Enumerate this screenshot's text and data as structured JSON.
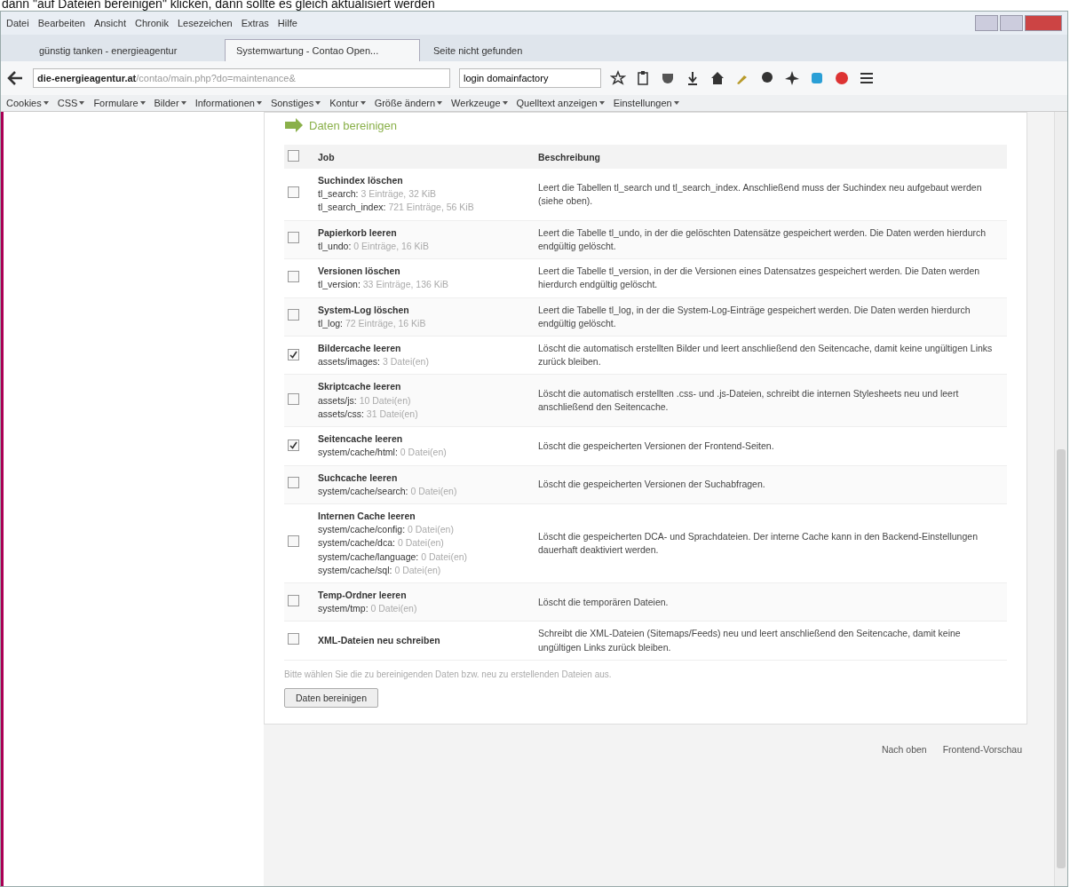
{
  "caption": "dann \"auf Dateien bereinigen\" klicken, dann sollte es gleich aktualisiert werden",
  "menu": [
    "Datei",
    "Bearbeiten",
    "Ansicht",
    "Chronik",
    "Lesezeichen",
    "Extras",
    "Hilfe"
  ],
  "tabs": [
    {
      "label": "günstig tanken - energieagentur",
      "selected": false
    },
    {
      "label": "Systemwartung - Contao Open...",
      "selected": true
    },
    {
      "label": "Seite nicht gefunden",
      "selected": false
    }
  ],
  "address": {
    "host": "die-energieagentur.at",
    "path": "/contao/main.php?do=maintenance&"
  },
  "search": {
    "value": "login domainfactory"
  },
  "dev_toolbar": [
    "Cookies",
    "CSS",
    "Formulare",
    "Bilder",
    "Informationen",
    "Sonstiges",
    "Kontur",
    "Größe ändern",
    "Werkzeuge",
    "Quelltext anzeigen",
    "Einstellungen"
  ],
  "section": {
    "title": "Daten bereinigen",
    "columns": [
      "Job",
      "Beschreibung"
    ],
    "select_all": {
      "checked": false
    },
    "jobs": [
      {
        "name": "Suchindex löschen",
        "checked": false,
        "details": [
          {
            "path": "tl_search:",
            "info": "3 Einträge, 32 KiB"
          },
          {
            "path": "tl_search_index:",
            "info": "721 Einträge, 56 KiB"
          }
        ],
        "description": "Leert die Tabellen tl_search und tl_search_index. Anschließend muss der Suchindex neu aufgebaut werden (siehe oben)."
      },
      {
        "name": "Papierkorb leeren",
        "checked": false,
        "details": [
          {
            "path": "tl_undo:",
            "info": "0 Einträge, 16 KiB"
          }
        ],
        "description": "Leert die Tabelle tl_undo, in der die gelöschten Datensätze gespeichert werden. Die Daten werden hierdurch endgültig gelöscht."
      },
      {
        "name": "Versionen löschen",
        "checked": false,
        "details": [
          {
            "path": "tl_version:",
            "info": "33 Einträge, 136 KiB"
          }
        ],
        "description": "Leert die Tabelle tl_version, in der die Versionen eines Datensatzes gespeichert werden. Die Daten werden hierdurch endgültig gelöscht."
      },
      {
        "name": "System-Log löschen",
        "checked": false,
        "details": [
          {
            "path": "tl_log:",
            "info": "72 Einträge, 16 KiB"
          }
        ],
        "description": "Leert die Tabelle tl_log, in der die System-Log-Einträge gespeichert werden. Die Daten werden hierdurch endgültig gelöscht."
      },
      {
        "name": "Bildercache leeren",
        "checked": true,
        "details": [
          {
            "path": "assets/images:",
            "info": "3 Datei(en)"
          }
        ],
        "description": "Löscht die automatisch erstellten Bilder und leert anschließend den Seitencache, damit keine ungültigen Links zurück bleiben."
      },
      {
        "name": "Skriptcache leeren",
        "checked": false,
        "details": [
          {
            "path": "assets/js:",
            "info": "10 Datei(en)"
          },
          {
            "path": "assets/css:",
            "info": "31 Datei(en)"
          }
        ],
        "description": "Löscht die automatisch erstellten .css- und .js-Dateien, schreibt die internen Stylesheets neu und leert anschließend den Seitencache."
      },
      {
        "name": "Seitencache leeren",
        "checked": true,
        "details": [
          {
            "path": "system/cache/html:",
            "info": "0 Datei(en)"
          }
        ],
        "description": "Löscht die gespeicherten Versionen der Frontend-Seiten."
      },
      {
        "name": "Suchcache leeren",
        "checked": false,
        "details": [
          {
            "path": "system/cache/search:",
            "info": "0 Datei(en)"
          }
        ],
        "description": "Löscht die gespeicherten Versionen der Suchabfragen."
      },
      {
        "name": "Internen Cache leeren",
        "checked": false,
        "details": [
          {
            "path": "system/cache/config:",
            "info": "0 Datei(en)"
          },
          {
            "path": "system/cache/dca:",
            "info": "0 Datei(en)"
          },
          {
            "path": "system/cache/language:",
            "info": "0 Datei(en)"
          },
          {
            "path": "system/cache/sql:",
            "info": "0 Datei(en)"
          }
        ],
        "description": "Löscht die gespeicherten DCA- und Sprachdateien. Der interne Cache kann in den Backend-Einstellungen dauerhaft deaktiviert werden."
      },
      {
        "name": "Temp-Ordner leeren",
        "checked": false,
        "details": [
          {
            "path": "system/tmp:",
            "info": "0 Datei(en)"
          }
        ],
        "description": "Löscht die temporären Dateien."
      },
      {
        "name": "XML-Dateien neu schreiben",
        "checked": false,
        "description": "Schreibt die XML-Dateien (Sitemaps/Feeds) neu und leert anschließend den Seitencache, damit keine ungültigen Links zurück bleiben."
      }
    ],
    "hint": "Bitte wählen Sie die zu bereinigenden Daten bzw. neu zu erstellenden Dateien aus.",
    "button": "Daten bereinigen"
  },
  "footer": [
    "Nach oben",
    "Frontend-Vorschau"
  ]
}
